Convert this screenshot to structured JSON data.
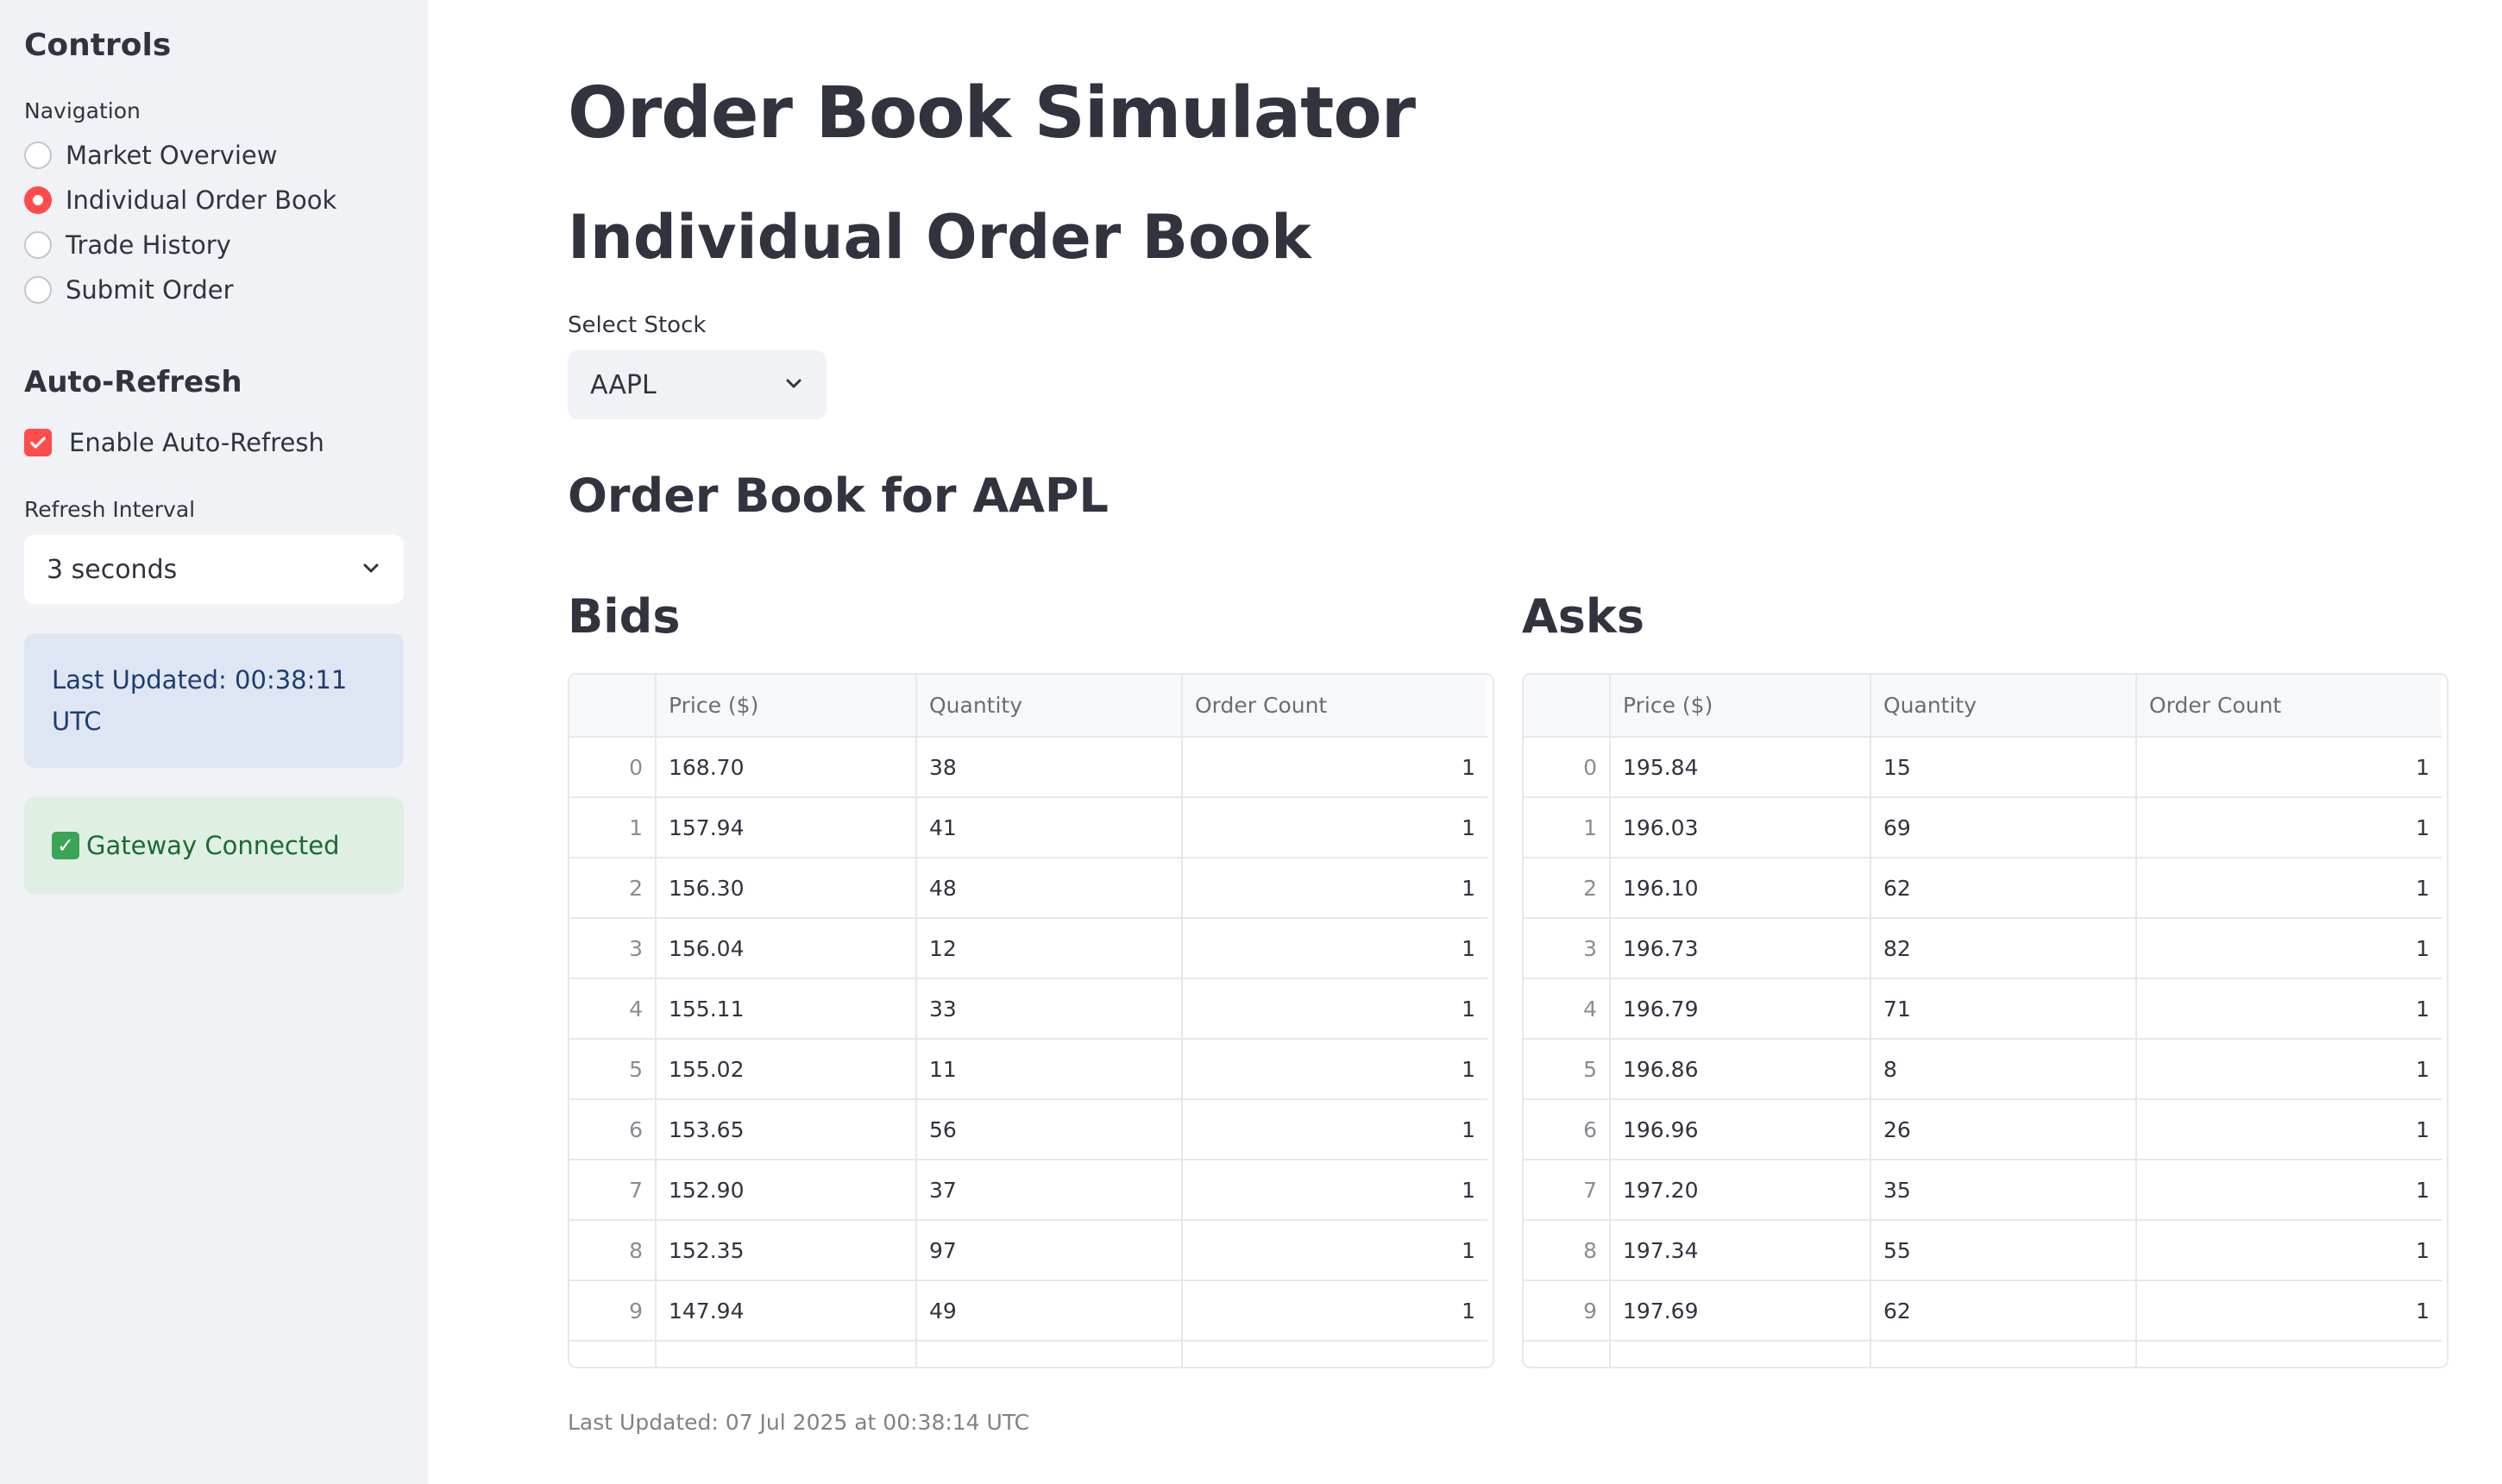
{
  "sidebar": {
    "title": "Controls",
    "nav_label": "Navigation",
    "nav_items": [
      {
        "label": "Market Overview",
        "selected": false
      },
      {
        "label": "Individual Order Book",
        "selected": true
      },
      {
        "label": "Trade History",
        "selected": false
      },
      {
        "label": "Submit Order",
        "selected": false
      }
    ],
    "auto_refresh_title": "Auto-Refresh",
    "enable_auto_refresh_label": "Enable Auto-Refresh",
    "enable_auto_refresh_checked": true,
    "refresh_interval_label": "Refresh Interval",
    "refresh_interval_value": "3 seconds",
    "last_updated": "Last Updated: 00:38:11 UTC",
    "gateway_status": "Gateway Connected"
  },
  "main": {
    "title": "Order Book Simulator",
    "section_title": "Individual Order Book",
    "select_stock_label": "Select Stock",
    "select_stock_value": "AAPL",
    "order_book_title": "Order Book for AAPL",
    "columns": [
      "",
      "Price ($)",
      "Quantity",
      "Order Count"
    ],
    "bids": {
      "title": "Bids",
      "rows": [
        [
          "0",
          "168.70",
          "38",
          "1"
        ],
        [
          "1",
          "157.94",
          "41",
          "1"
        ],
        [
          "2",
          "156.30",
          "48",
          "1"
        ],
        [
          "3",
          "156.04",
          "12",
          "1"
        ],
        [
          "4",
          "155.11",
          "33",
          "1"
        ],
        [
          "5",
          "155.02",
          "11",
          "1"
        ],
        [
          "6",
          "153.65",
          "56",
          "1"
        ],
        [
          "7",
          "152.90",
          "37",
          "1"
        ],
        [
          "8",
          "152.35",
          "97",
          "1"
        ],
        [
          "9",
          "147.94",
          "49",
          "1"
        ]
      ]
    },
    "asks": {
      "title": "Asks",
      "rows": [
        [
          "0",
          "195.84",
          "15",
          "1"
        ],
        [
          "1",
          "196.03",
          "69",
          "1"
        ],
        [
          "2",
          "196.10",
          "62",
          "1"
        ],
        [
          "3",
          "196.73",
          "82",
          "1"
        ],
        [
          "4",
          "196.79",
          "71",
          "1"
        ],
        [
          "5",
          "196.86",
          "8",
          "1"
        ],
        [
          "6",
          "196.96",
          "26",
          "1"
        ],
        [
          "7",
          "197.20",
          "35",
          "1"
        ],
        [
          "8",
          "197.34",
          "55",
          "1"
        ],
        [
          "9",
          "197.69",
          "62",
          "1"
        ]
      ]
    },
    "footer": "Last Updated: 07 Jul 2025 at 00:38:14 UTC"
  },
  "colors": {
    "accent": "#ff4b4b",
    "sidebar_bg": "#f0f2f6",
    "info_bg": "#dfe6f3",
    "success_bg": "#e0efe4"
  },
  "icons": {
    "select_chevron": "chevron-down-icon",
    "checkbox": "check-icon",
    "status": "check-mark-button-icon"
  }
}
